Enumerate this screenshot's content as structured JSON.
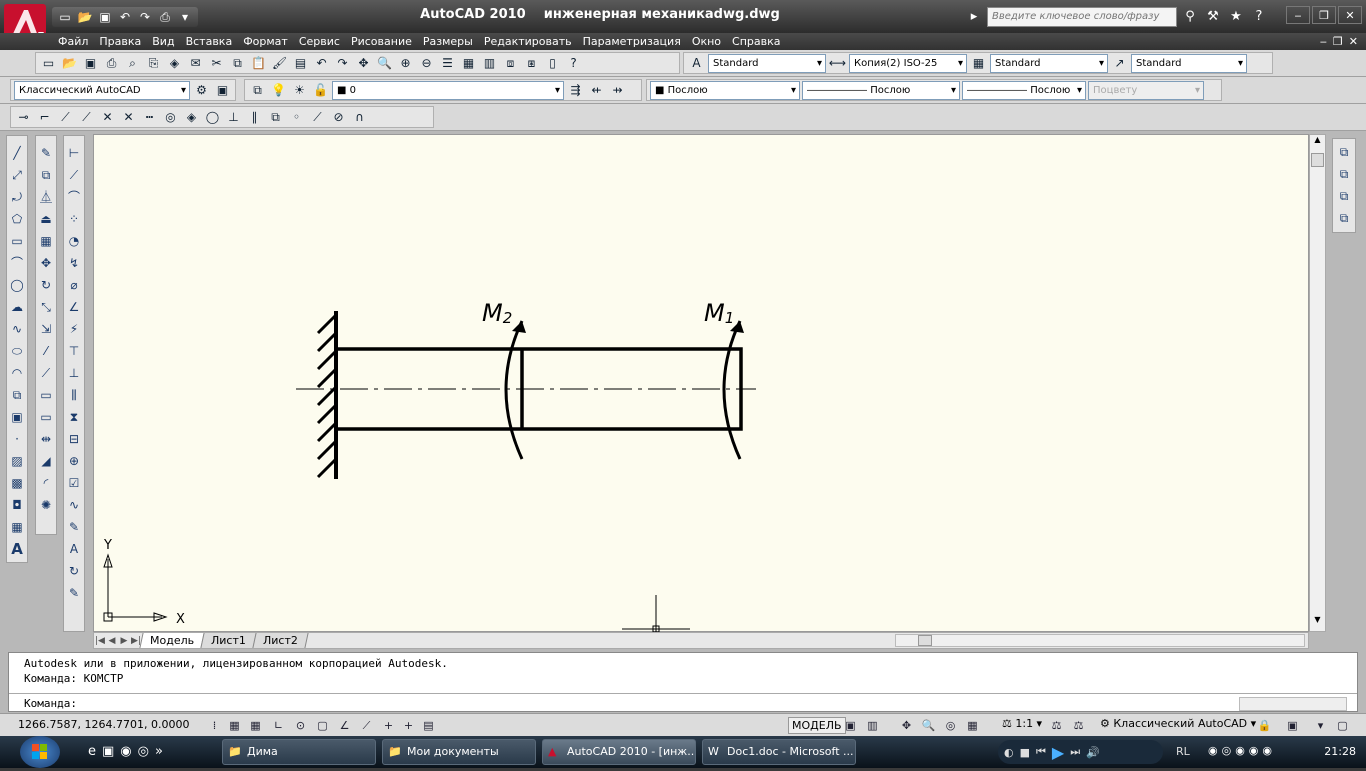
{
  "window": {
    "title": "AutoCAD 2010    инженерная механикаdwg.dwg",
    "search_placeholder": "Введите ключевое слово/фразу"
  },
  "menu": [
    "Файл",
    "Правка",
    "Вид",
    "Вставка",
    "Формат",
    "Сервис",
    "Рисование",
    "Размеры",
    "Редактировать",
    "Параметризация",
    "Окно",
    "Справка"
  ],
  "styles": {
    "text_style": "Standard",
    "dim_style": "Копия(2) ISO-25",
    "table_style": "Standard",
    "mleader_style": "Standard"
  },
  "workspace_select": "Классический AutoCAD",
  "layer_select": "0",
  "properties": {
    "color": "Послою",
    "linetype": "Послою",
    "lineweight": "Послою",
    "plotstyle": "Поцвету"
  },
  "drawing": {
    "label_m1": "M",
    "label_m1_sub": "1",
    "label_m2": "M",
    "label_m2_sub": "2",
    "ucs_x": "X",
    "ucs_y": "Y"
  },
  "tabs": [
    "Модель",
    "Лист1",
    "Лист2"
  ],
  "command": {
    "line1": "Autodesk или в приложении, лицензированном корпорацией Autodesk.",
    "line2": "Команда: КОМСТР",
    "prompt": "Команда:"
  },
  "status": {
    "coords": "1266.7587, 1264.7701, 0.0000",
    "model": "МОДЕЛЬ",
    "scale": "1:1",
    "workspace": "Классический AutoCAD"
  },
  "taskbar": {
    "tasks": [
      "Дима",
      "Мои документы",
      "AutoCAD 2010 - [инж...",
      "Doc1.doc - Microsoft ..."
    ],
    "lang": "RL",
    "clock": "21:28"
  },
  "colors": {
    "titlebar": "#3a3a3a",
    "canvas": "#fdfcef",
    "accent": "#c8102e"
  }
}
